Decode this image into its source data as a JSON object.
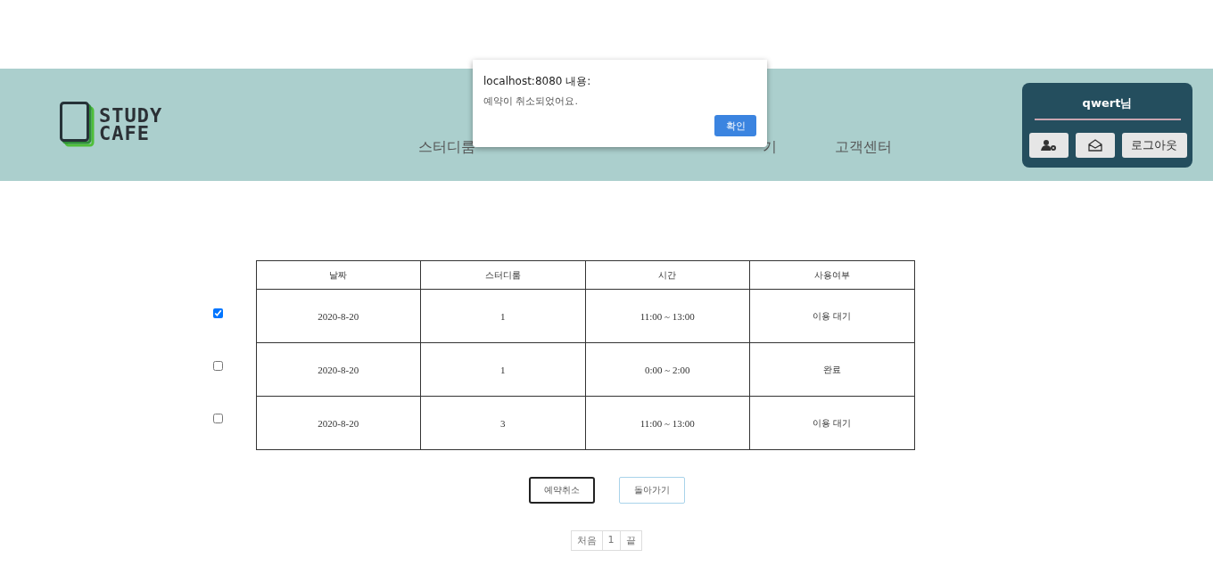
{
  "header": {
    "logo": {
      "line_1": "STUDY",
      "line_2": "CAFE"
    },
    "nav": [
      {
        "label": "스터디룸"
      },
      {
        "label": "기"
      },
      {
        "label": "고객센터"
      }
    ],
    "user_panel": {
      "greeting": "qwert님",
      "buttons": [
        {
          "kind": "account"
        },
        {
          "kind": "mail"
        },
        {
          "kind": "text",
          "label": "로그아웃"
        }
      ]
    }
  },
  "dialog": {
    "title": "localhost:8080 내용:",
    "message": "예약이 취소되었어요.",
    "button": "확인"
  },
  "table": {
    "columns": [
      "날짜",
      "스터디룸",
      "시간",
      "사용여부"
    ],
    "rows": [
      {
        "checked": true,
        "cells": [
          "2020-8-20",
          "1",
          "11:00 ~ 13:00",
          "이용 대기"
        ]
      },
      {
        "checked": false,
        "cells": [
          "2020-8-20",
          "1",
          "0:00 ~ 2:00",
          "완료"
        ]
      },
      {
        "checked": false,
        "cells": [
          "2020-8-20",
          "3",
          "11:00 ~ 13:00",
          "이용 대기"
        ]
      }
    ]
  },
  "actions": [
    {
      "label": "예약취소",
      "selected": true
    },
    {
      "label": "돌아가기",
      "selected": false
    }
  ],
  "pagination": [
    "처음",
    "1",
    "끝"
  ]
}
